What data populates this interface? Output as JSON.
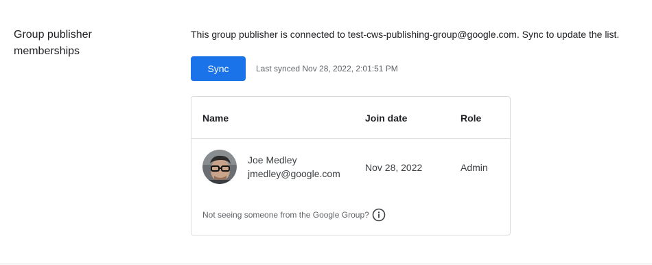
{
  "section": {
    "title_line1": "Group publisher",
    "title_line2": "memberships"
  },
  "description": "This group publisher is connected to test-cws-publishing-group@google.com. Sync to update the list.",
  "sync": {
    "button_label": "Sync",
    "last_synced": "Last synced Nov 28, 2022, 2:01:51 PM"
  },
  "table": {
    "columns": [
      "Name",
      "Join date",
      "Role"
    ],
    "rows": [
      {
        "name": "Joe Medley",
        "email": "jmedley@google.com",
        "join_date": "Nov 28, 2022",
        "role": "Admin",
        "avatar_icon": "user-photo-avatar"
      }
    ]
  },
  "help": {
    "text": "Not seeing someone from the Google Group?",
    "icon": "info-icon"
  },
  "colors": {
    "primary_button": "#1a73e8",
    "border": "#dadce0",
    "secondary_text": "#5f6368"
  }
}
